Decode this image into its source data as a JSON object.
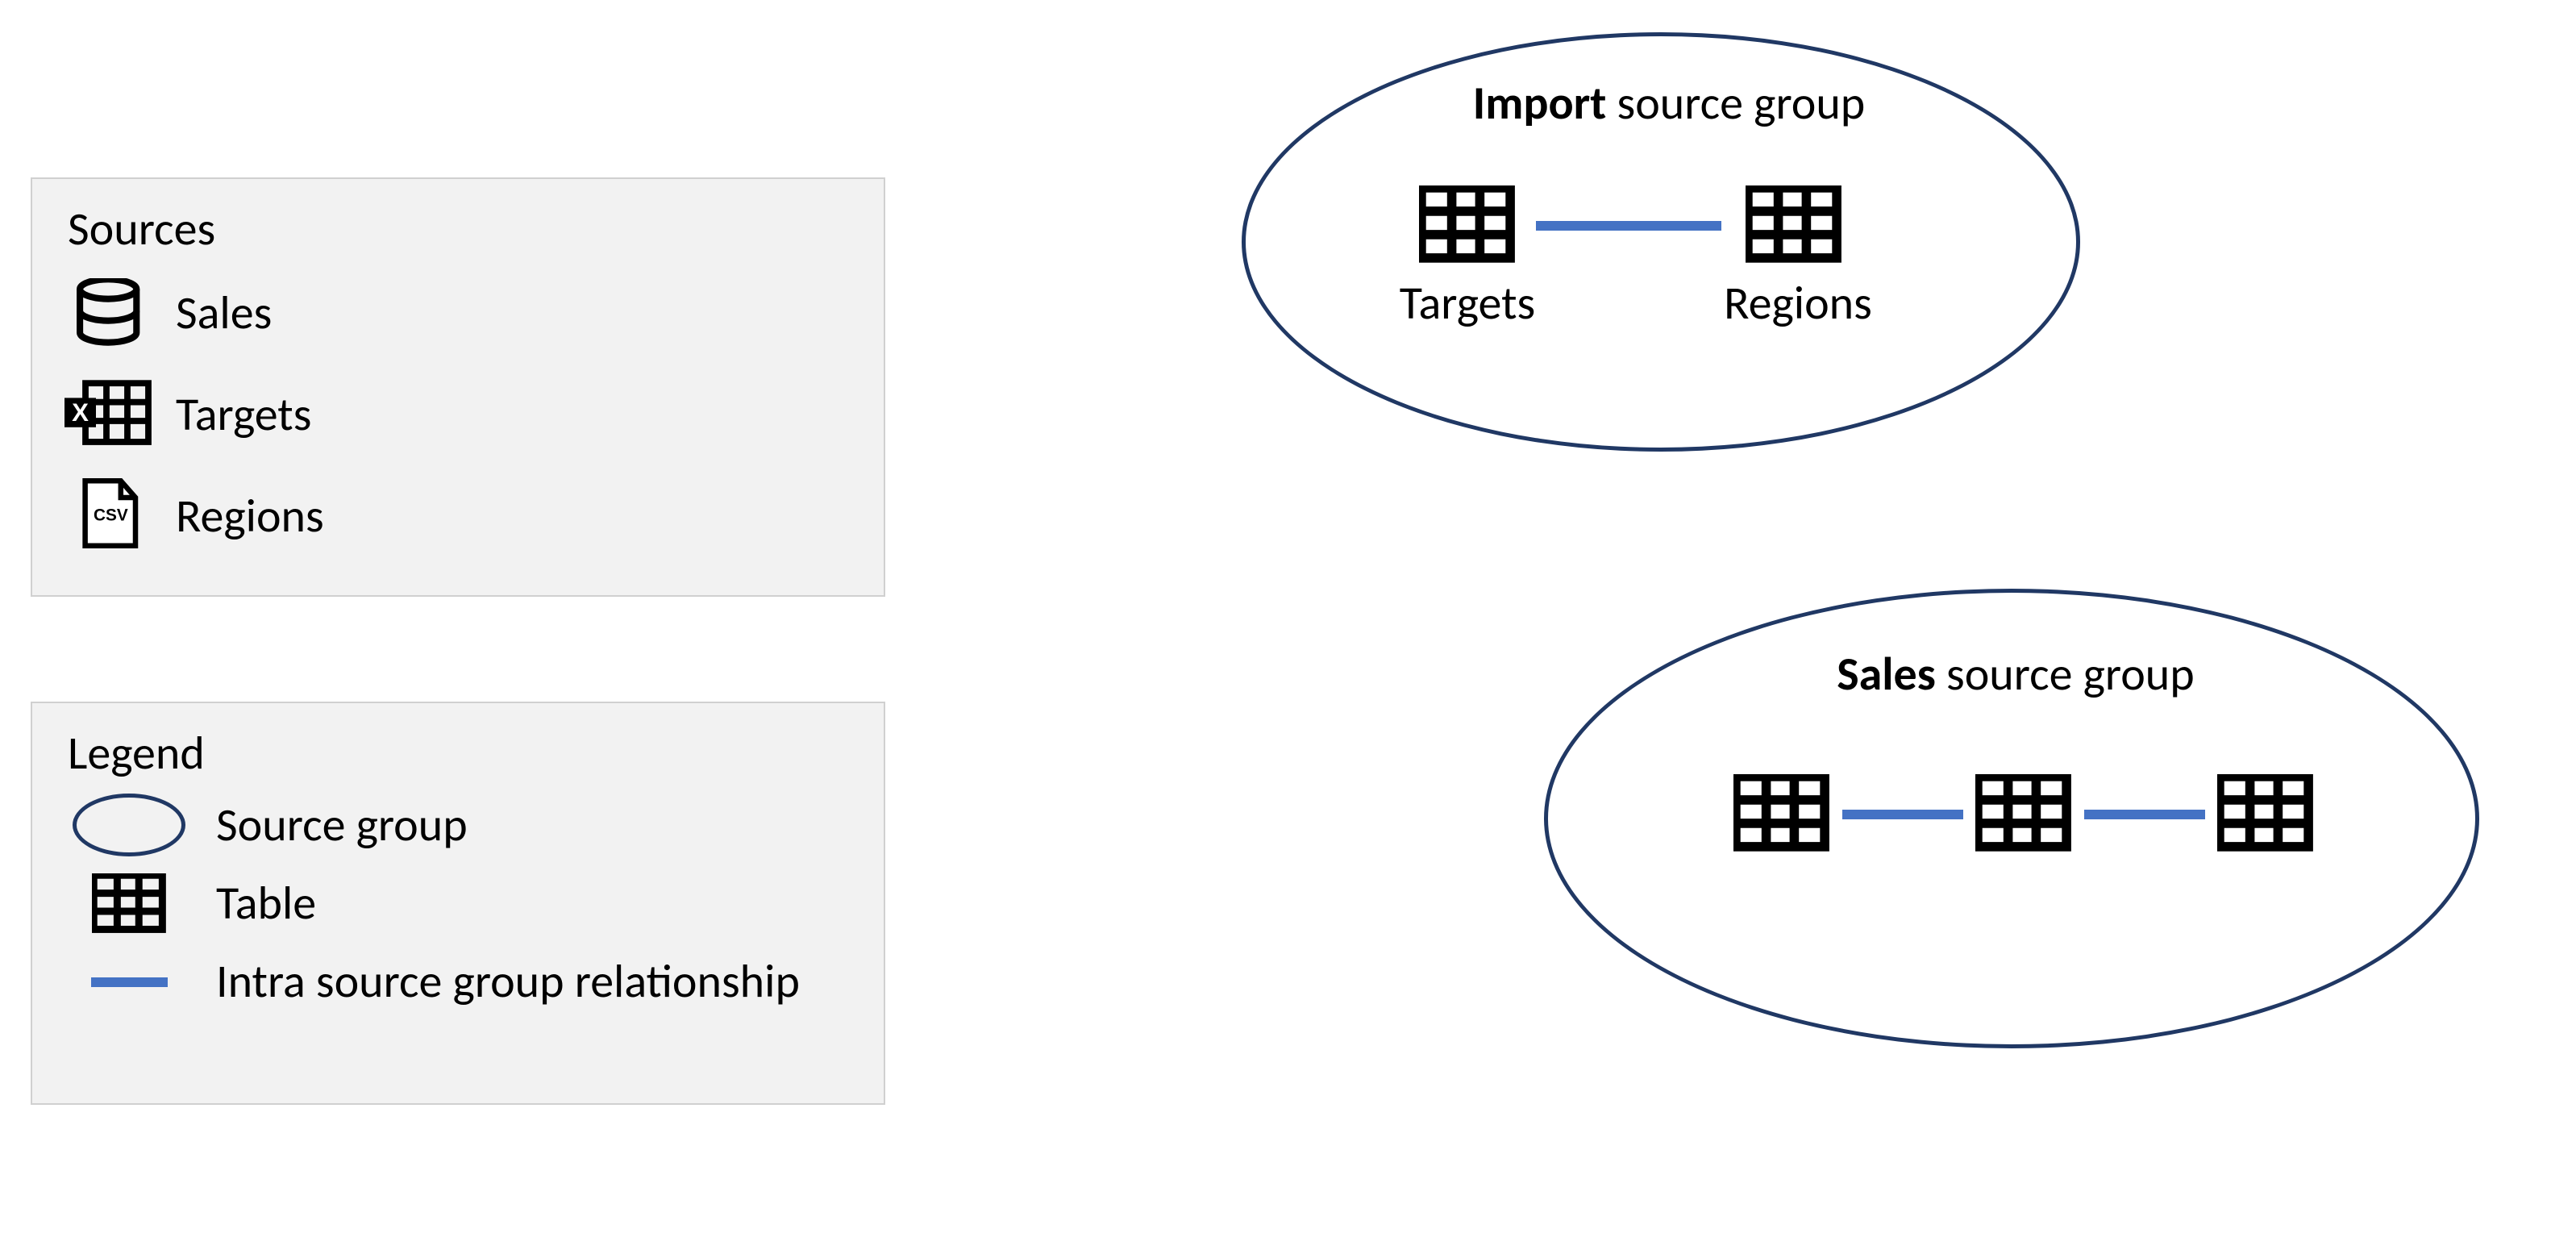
{
  "sources_panel": {
    "title": "Sources",
    "items": [
      {
        "icon": "database",
        "label": "Sales"
      },
      {
        "icon": "excel",
        "label": "Targets"
      },
      {
        "icon": "csv",
        "label": "Regions"
      }
    ]
  },
  "legend_panel": {
    "title": "Legend",
    "items": [
      {
        "icon": "ellipse",
        "label": "Source group"
      },
      {
        "icon": "table",
        "label": "Table"
      },
      {
        "icon": "line",
        "label": "Intra source group relationship"
      }
    ]
  },
  "groups": {
    "import": {
      "title_bold": "Import",
      "title_rest": " source group",
      "tables": [
        "Targets",
        "Regions"
      ]
    },
    "sales": {
      "title_bold": "Sales",
      "title_rest": " source group",
      "n_tables": 3
    }
  },
  "colors": {
    "ellipse_border": "#203864",
    "relationship_line": "#4472c4",
    "panel_bg": "#f2f2f2"
  }
}
